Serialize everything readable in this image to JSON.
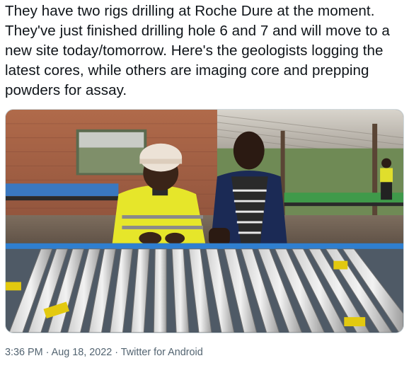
{
  "tweet": {
    "text": "They have two rigs drilling at Roche Dure at the moment. They've just finished drilling hole 6 and 7 and will move to a new site today/tomorrow. Here's the geologists logging the latest cores, while others are imaging core and prepping powders for assay.",
    "media": {
      "icon": "photo"
    },
    "meta": {
      "time": "3:36 PM",
      "separator1": " · ",
      "date": "Aug 18, 2022",
      "separator2": " · ",
      "source": "Twitter for Android"
    }
  },
  "colors": {
    "text": "#0f1419",
    "secondary_text": "#536471",
    "border": "#cfd9de",
    "hi_vis_yellow": "#e6e62a",
    "core_tray_blue": "#2f7fd0"
  }
}
